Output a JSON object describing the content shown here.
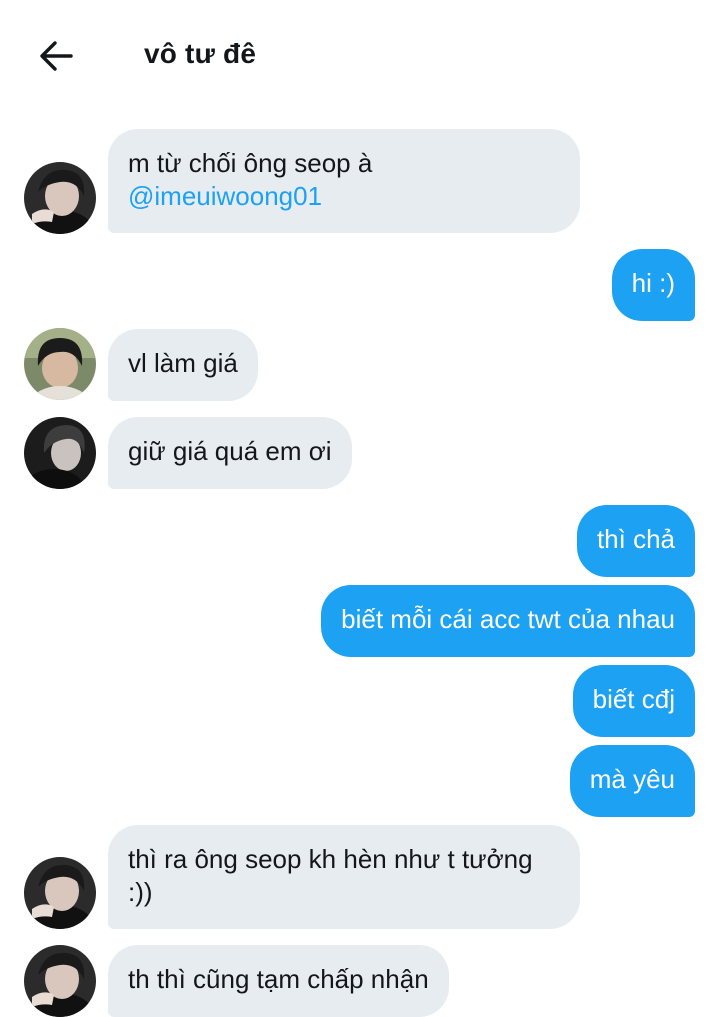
{
  "header": {
    "title": "vô tư đê",
    "back_icon": "arrow-left-icon"
  },
  "messages": [
    {
      "side": "in",
      "text": "m từ chối ông seop à",
      "mention": "@imeuiwoong01",
      "avatar": "avatar-a"
    },
    {
      "side": "out",
      "text": "hi :)"
    },
    {
      "side": "in",
      "text": "vl làm giá",
      "avatar": "avatar-b"
    },
    {
      "side": "in",
      "text": "giữ giá quá em ơi",
      "avatar": "avatar-c"
    },
    {
      "side": "out",
      "text": "thì chả"
    },
    {
      "side": "out",
      "text": "biết mỗi cái acc twt của nhau"
    },
    {
      "side": "out",
      "text": "biết cđj"
    },
    {
      "side": "out",
      "text": "mà yêu"
    },
    {
      "side": "in",
      "text": "thì ra ông seop kh hèn như t tưởng",
      "text2": ":))",
      "avatar": "avatar-a"
    },
    {
      "side": "in",
      "text": "th thì cũng tạm chấp nhận",
      "avatar": "avatar-a"
    }
  ],
  "colors": {
    "incoming_bubble": "#e6ecf0",
    "outgoing_bubble": "#1da1f2",
    "mention": "#1da1f2"
  }
}
